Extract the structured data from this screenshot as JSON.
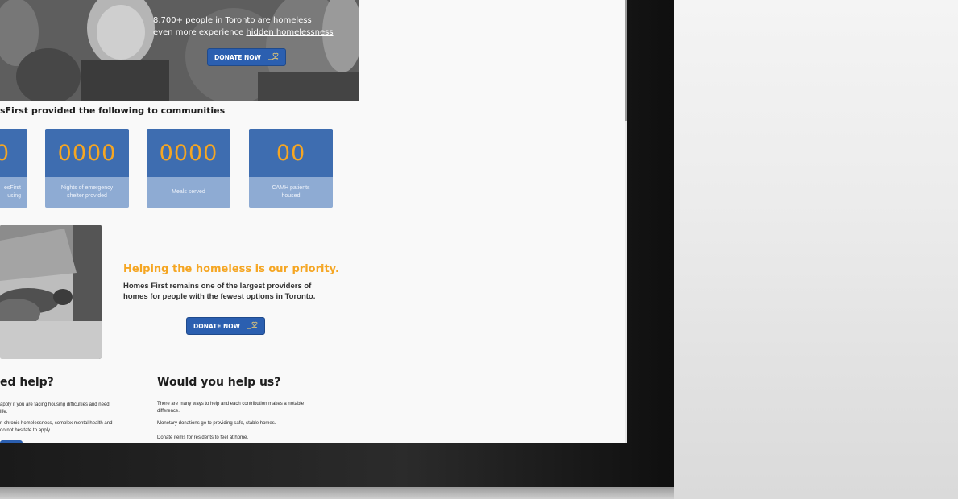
{
  "hero": {
    "line1": "8,700+ people in Toronto are homeless",
    "line2_prefix": "even more experience ",
    "line2_link": "hidden homelessness",
    "donate_label": "DONATE NOW"
  },
  "stats": {
    "title": "sFirst provided the following to communities",
    "cards": [
      {
        "value": "0",
        "label_line1": "esFirst",
        "label_line2": "using"
      },
      {
        "value": "0000",
        "label_line1": "Nights of emergency",
        "label_line2": "shelter provided"
      },
      {
        "value": "0000",
        "label_line1": "Meals served",
        "label_line2": ""
      },
      {
        "value": "00",
        "label_line1": "CAMH patients",
        "label_line2": "housed"
      }
    ]
  },
  "priority": {
    "title": "Helping the homeless is our priority.",
    "line1": "Homes First remains one of the largest providers of",
    "line2": "homes for people with the fewest options in Toronto.",
    "donate_label": "DONATE NOW"
  },
  "need_help": {
    "title": "ed help?",
    "p1_line1": "apply if you are facing housing difficulties and need",
    "p1_line2": "life.",
    "p2_line1": "n chronic homelessness, complex mental health and",
    "p2_line2": "do not hesitate to apply."
  },
  "help_us": {
    "title": "Would you help us?",
    "p1_line1": "There are many ways to help and each contribution makes a notable",
    "p1_line2": "difference.",
    "p2": "Monetary donations go to providing safe, stable homes.",
    "p3": "Donate items for residents to feel at home."
  },
  "colors": {
    "accent_blue": "#2b5fb0",
    "card_blue": "#3e6db0",
    "card_light": "#8eabd3",
    "accent_orange": "#f5a623"
  },
  "icons": [
    "hand-heart-icon"
  ]
}
